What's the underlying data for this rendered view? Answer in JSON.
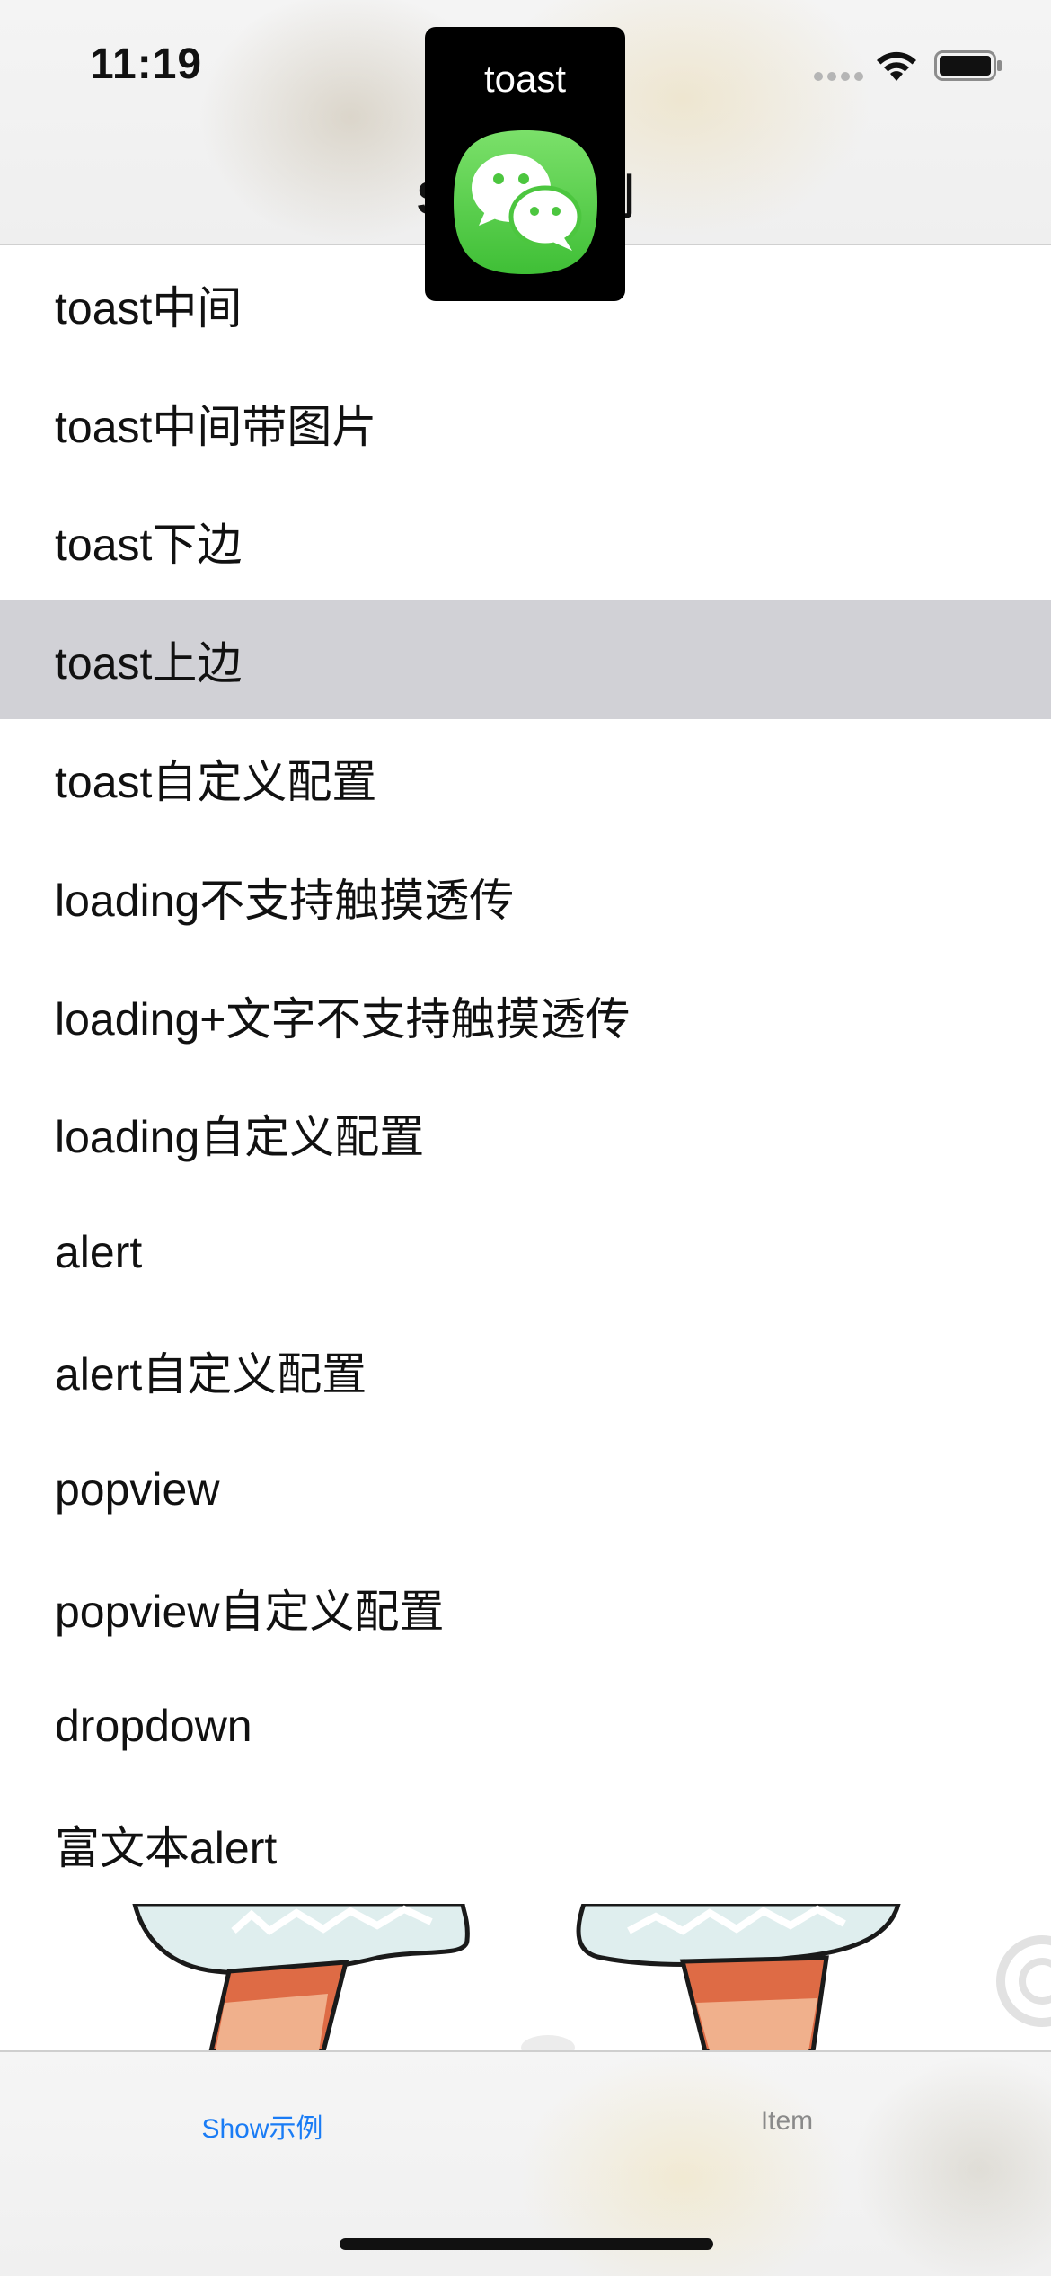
{
  "status_bar": {
    "time": "11:19"
  },
  "nav": {
    "title": "Show示例"
  },
  "menu": {
    "items": [
      {
        "label": "toast中间"
      },
      {
        "label": "toast中间带图片"
      },
      {
        "label": "toast下边"
      },
      {
        "label": "toast上边",
        "selected": true
      },
      {
        "label": "toast自定义配置"
      },
      {
        "label": "loading不支持触摸透传"
      },
      {
        "label": "loading+文字不支持触摸透传"
      },
      {
        "label": "loading自定义配置"
      },
      {
        "label": "alert"
      },
      {
        "label": "alert自定义配置"
      },
      {
        "label": "popview"
      },
      {
        "label": "popview自定义配置"
      },
      {
        "label": "dropdown"
      },
      {
        "label": "富文本alert"
      }
    ]
  },
  "toast": {
    "text": "toast",
    "icon": "wechat-icon"
  },
  "tab_bar": {
    "tabs": [
      {
        "label": "Show示例",
        "active": true
      },
      {
        "label": "Item",
        "active": false
      }
    ]
  },
  "colors": {
    "accent": "#1a7cf5",
    "selected_row": "#d1d1d6",
    "toast_bg": "#000000",
    "wechat_green": "#5bd04b"
  }
}
